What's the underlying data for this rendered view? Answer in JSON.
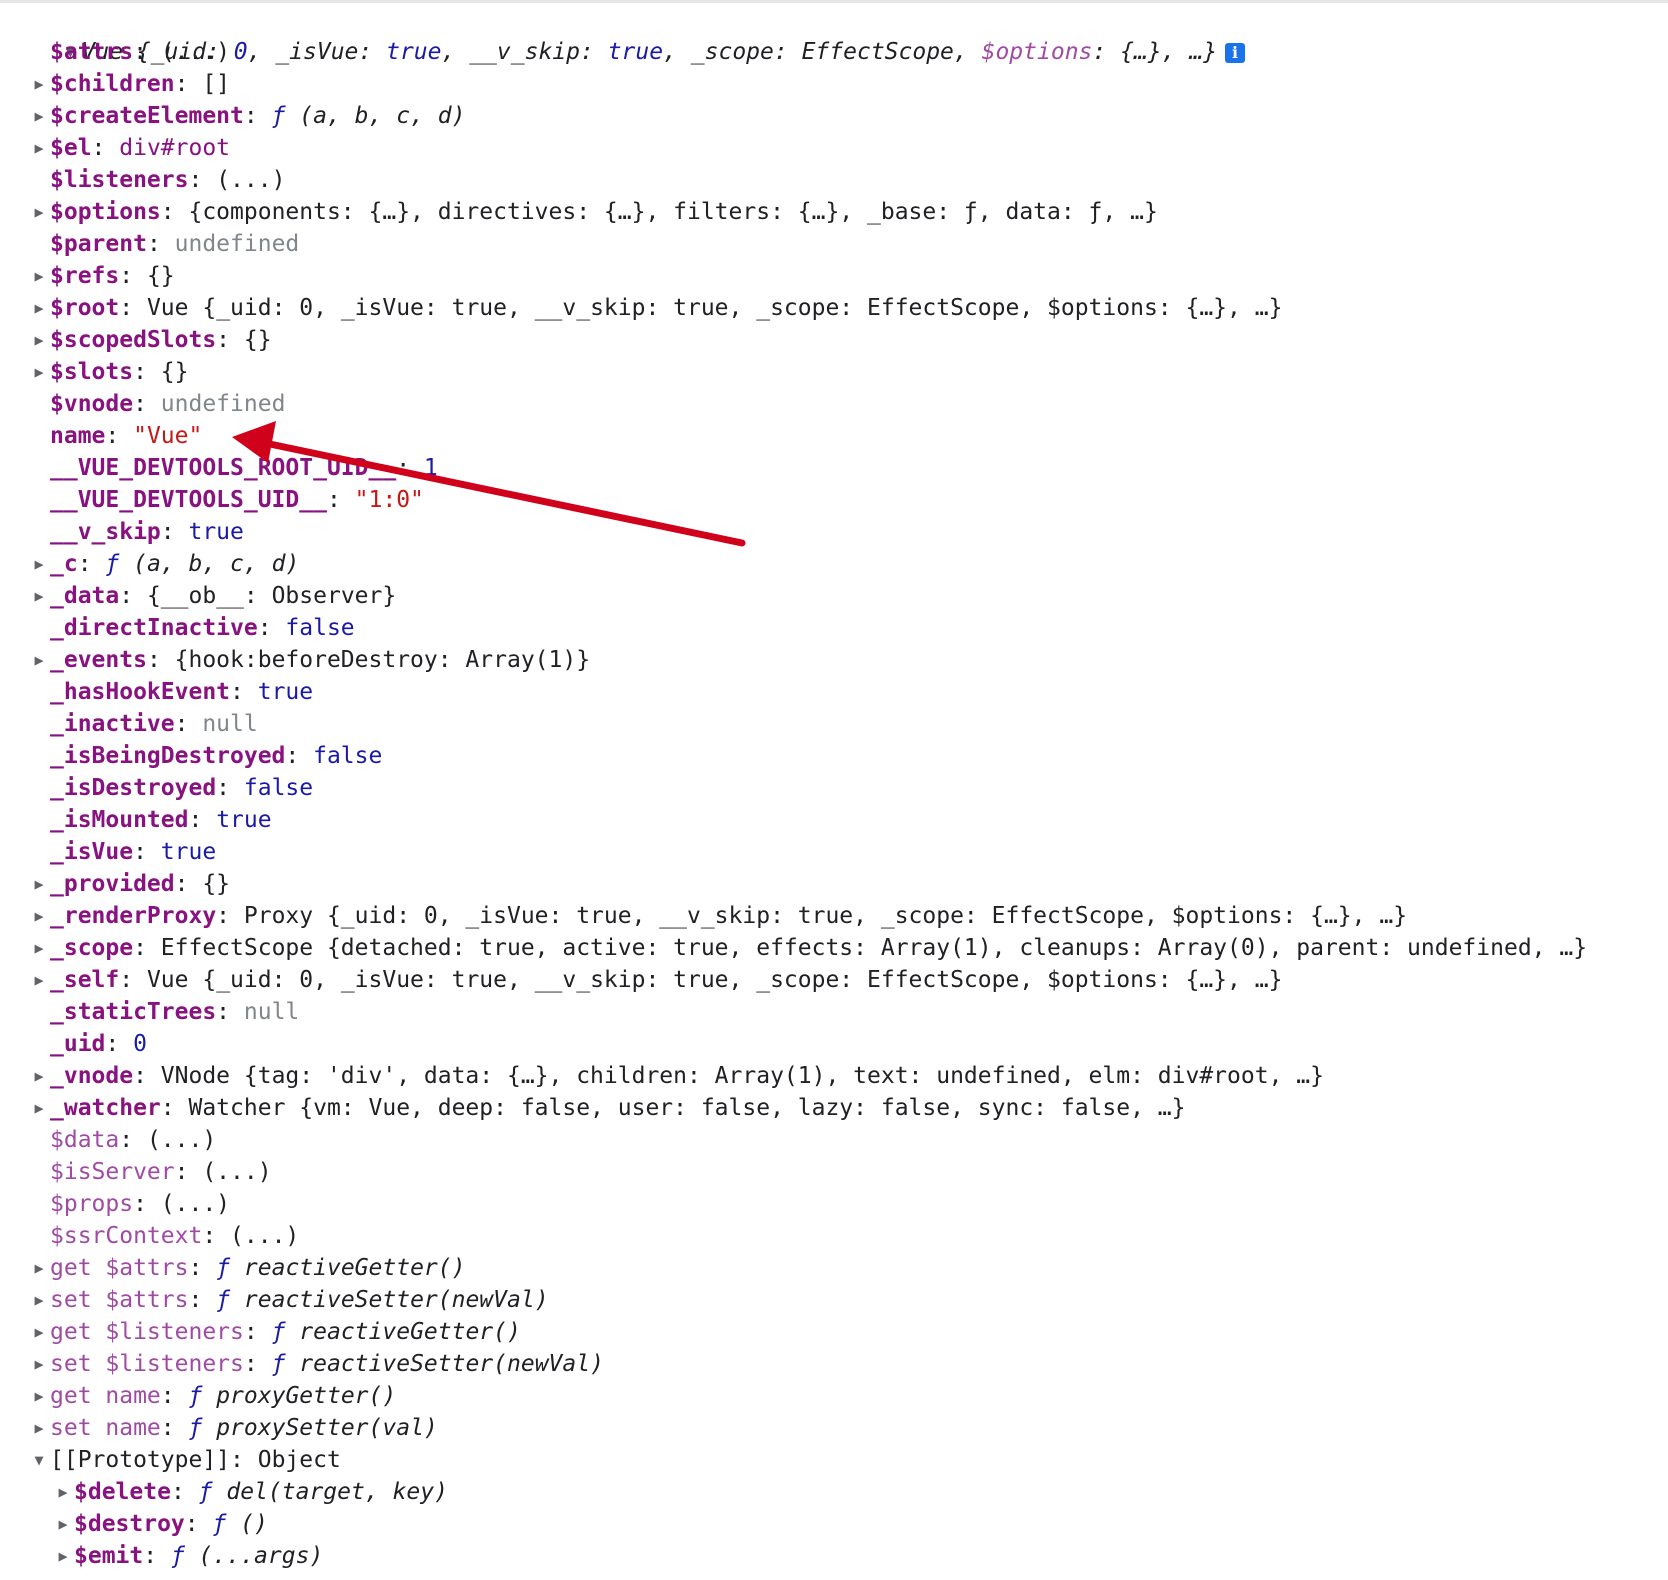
{
  "header": {
    "class_name": "Vue",
    "preview_open": "{",
    "uid_key": "_uid",
    "uid_val": "0",
    "isvue_key": "_isVue",
    "isvue_val": "true",
    "vskip_key": "__v_skip",
    "vskip_val": "true",
    "scope_key": "_scope",
    "scope_val": "EffectScope",
    "options_key": "$options",
    "options_val": "{…}",
    "ellipsis": "…}",
    "info_icon": "info-icon"
  },
  "props": {
    "attrs": {
      "key": "$attrs",
      "val": "(...)"
    },
    "children": {
      "key": "$children",
      "val": "[]"
    },
    "createElement": {
      "key": "$createElement",
      "f": "ƒ",
      "sig": "(a, b, c, d)"
    },
    "el": {
      "key": "$el",
      "val": "div#root"
    },
    "listeners": {
      "key": "$listeners",
      "val": "(...)"
    },
    "options": {
      "key": "$options",
      "val": "{components: {…}, directives: {…}, filters: {…}, _base: ƒ, data: ƒ, …}"
    },
    "parent": {
      "key": "$parent",
      "val": "undefined"
    },
    "refs": {
      "key": "$refs",
      "val": "{}"
    },
    "root": {
      "key": "$root",
      "val": "Vue {_uid: 0, _isVue: true, __v_skip: true, _scope: EffectScope, $options: {…}, …}"
    },
    "scopedSlots": {
      "key": "$scopedSlots",
      "val": "{}"
    },
    "slots": {
      "key": "$slots",
      "val": "{}"
    },
    "vnode_top": {
      "key": "$vnode",
      "val": "undefined"
    },
    "name": {
      "key": "name",
      "val": "\"Vue\""
    },
    "root_uid": {
      "key": "__VUE_DEVTOOLS_ROOT_UID__",
      "val": "1"
    },
    "devtools_uid": {
      "key": "__VUE_DEVTOOLS_UID__",
      "val": "\"1:0\""
    },
    "v_skip": {
      "key": "__v_skip",
      "val": "true"
    },
    "c": {
      "key": "_c",
      "f": "ƒ",
      "sig": "(a, b, c, d)"
    },
    "data": {
      "key": "_data",
      "val": "{__ob__: Observer}"
    },
    "directInactive": {
      "key": "_directInactive",
      "val": "false"
    },
    "events": {
      "key": "_events",
      "val": "{hook:beforeDestroy: Array(1)}"
    },
    "hasHookEvent": {
      "key": "_hasHookEvent",
      "val": "true"
    },
    "inactive": {
      "key": "_inactive",
      "val": "null"
    },
    "isBeingDestroyed": {
      "key": "_isBeingDestroyed",
      "val": "false"
    },
    "isDestroyed": {
      "key": "_isDestroyed",
      "val": "false"
    },
    "isMounted": {
      "key": "_isMounted",
      "val": "true"
    },
    "isVue": {
      "key": "_isVue",
      "val": "true"
    },
    "provided": {
      "key": "_provided",
      "val": "{}"
    },
    "renderProxy": {
      "key": "_renderProxy",
      "val": "Proxy {_uid: 0, _isVue: true, __v_skip: true, _scope: EffectScope, $options: {…}, …}"
    },
    "scope": {
      "key": "_scope",
      "val": "EffectScope {detached: true, active: true, effects: Array(1), cleanups: Array(0), parent: undefined, …}"
    },
    "self": {
      "key": "_self",
      "val": "Vue {_uid: 0, _isVue: true, __v_skip: true, _scope: EffectScope, $options: {…}, …}"
    },
    "staticTrees": {
      "key": "_staticTrees",
      "val": "null"
    },
    "uid": {
      "key": "_uid",
      "val": "0"
    },
    "vnode": {
      "key": "_vnode",
      "val": "VNode {tag: 'div', data: {…}, children: Array(1), text: undefined, elm: div#root, …}"
    },
    "watcher": {
      "key": "_watcher",
      "val": "Watcher {vm: Vue, deep: false, user: false, lazy: false, sync: false, …}"
    },
    "data_acc": {
      "key": "$data",
      "val": "(...)"
    },
    "isServer": {
      "key": "$isServer",
      "val": "(...)"
    },
    "props_acc": {
      "key": "$props",
      "val": "(...)"
    },
    "ssrContext": {
      "key": "$ssrContext",
      "val": "(...)"
    },
    "get_attrs": {
      "key": "get $attrs",
      "f": "ƒ",
      "sig": "reactiveGetter()"
    },
    "set_attrs": {
      "key": "set $attrs",
      "f": "ƒ",
      "sig": "reactiveSetter(newVal)"
    },
    "get_listeners": {
      "key": "get $listeners",
      "f": "ƒ",
      "sig": "reactiveGetter()"
    },
    "set_listeners": {
      "key": "set $listeners",
      "f": "ƒ",
      "sig": "reactiveSetter(newVal)"
    },
    "get_name": {
      "key": "get name",
      "f": "ƒ",
      "sig": "proxyGetter()"
    },
    "set_name": {
      "key": "set name",
      "f": "ƒ",
      "sig": "proxySetter(val)"
    },
    "prototype": {
      "key": "[[Prototype]]",
      "val": "Object"
    },
    "delete": {
      "key": "$delete",
      "f": "ƒ",
      "sig": "del(target, key)"
    },
    "destroy": {
      "key": "$destroy",
      "f": "ƒ",
      "sig": "()"
    },
    "emit": {
      "key": "$emit",
      "f": "ƒ",
      "sig": "(...args)"
    }
  },
  "glyphs": {
    "expanded": "▼",
    "collapsed": "▶",
    "colon": ": "
  },
  "colors": {
    "key": "#881280",
    "string": "#c41a16",
    "keyword": "#1a1aa6",
    "muted": "#80868b",
    "annotation_arrow": "#d0021b"
  }
}
